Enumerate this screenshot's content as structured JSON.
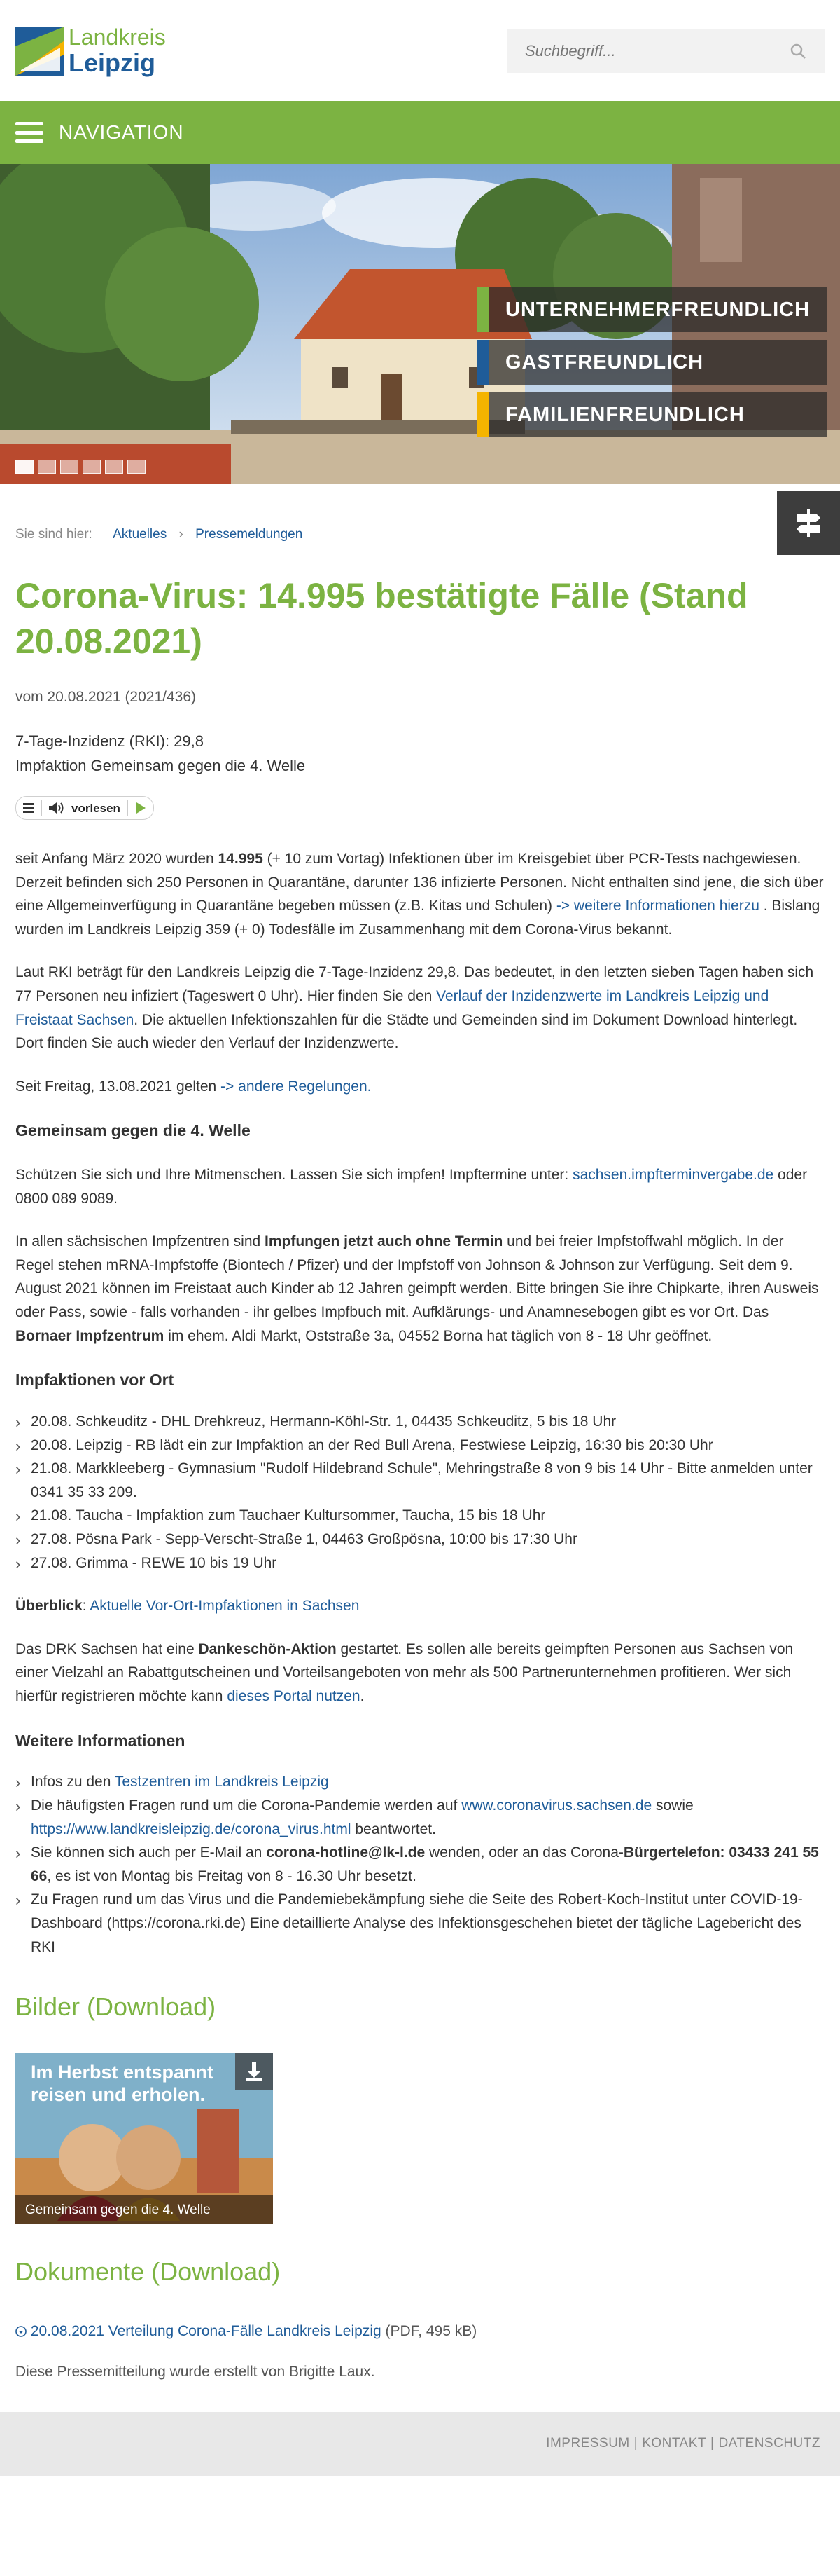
{
  "header": {
    "logo_line1": "Landkreis",
    "logo_line2": "Leipzig",
    "search_placeholder": "Suchbegriff..."
  },
  "nav": {
    "label": "NAVIGATION"
  },
  "hero": {
    "slogans": [
      {
        "text": "UNTERNEHMERFREUNDLICH",
        "color": "#7cb342"
      },
      {
        "text": "GASTFREUNDLICH",
        "color": "#1f5c99"
      },
      {
        "text": "FAMILIENFREUNDLICH",
        "color": "#f4b400"
      }
    ],
    "active_slide": 1,
    "slide_count": 6
  },
  "breadcrumb": {
    "prefix": "Sie sind hier:",
    "items": [
      "Aktuelles",
      "Pressemeldungen"
    ]
  },
  "article": {
    "title": "Corona-Virus: 14.995 bestätigte Fälle (Stand 20.08.2021)",
    "date": "vom 20.08.2021 (2021/436)",
    "lead_1": "7-Tage-Inzidenz (RKI): 29,8",
    "lead_2": "Impfaktion Gemeinsam gegen die 4. Welle",
    "reader_label": "vorlesen",
    "p1_a": "seit Anfang März 2020 wurden ",
    "p1_b": "14.995",
    "p1_c": " (+ 10 zum Vortag) Infektionen über im Kreisgebiet über PCR-Tests nachgewiesen. Derzeit befinden sich 250 Personen in Quarantäne, darunter 136 infizierte Personen. Nicht enthalten sind jene, die sich über eine Allgemeinverfügung in Quarantäne begeben müssen (z.B. Kitas und Schulen) ",
    "p1_link": "-> weitere Informationen hierzu",
    "p1_d": " . Bislang wurden im Landkreis Leipzig 359 (+ 0) Todesfälle im Zusammenhang mit dem Corona-Virus bekannt.",
    "p2_a": "Laut RKI beträgt für den Landkreis Leipzig die 7-Tage-Inzidenz 29,8. Das bedeutet, in den letzten sieben Tagen haben sich 77 Personen neu infiziert (Tageswert 0 Uhr). Hier finden Sie den ",
    "p2_link": "Verlauf der Inzidenzwerte im Landkreis Leipzig und Freistaat Sachsen",
    "p2_b": ". Die aktuellen Infektionszahlen für die Städte und Gemeinden sind im Dokument Download hinterlegt. Dort finden Sie auch wieder den Verlauf der Inzidenzwerte.",
    "p3_a": "Seit Freitag, 13.08.2021 gelten  ",
    "p3_link": "-> andere Regelungen.",
    "h_welle": "Gemeinsam gegen die 4. Welle",
    "p4_a": "Schützen Sie sich und Ihre Mitmenschen. Lassen Sie sich impfen! Impftermine unter: ",
    "p4_link": "sachsen.impfterminvergabe.de",
    "p4_b": " oder 0800 089 9089.",
    "p5_a": "In allen sächsischen Impfzentren sind ",
    "p5_b": "Impfungen jetzt auch ohne Termin",
    "p5_c": " und bei freier Impfstoffwahl möglich. In der Regel stehen mRNA-Impfstoffe (Biontech / Pfizer) und der Impfstoff von Johnson & Johnson zur Verfügung. Seit dem 9. August 2021 können im Freistaat auch Kinder ab 12 Jahren geimpft werden. Bitte bringen Sie ihre Chipkarte, ihren Ausweis oder Pass, sowie - falls vorhanden - ihr gelbes Impfbuch mit. Aufklärungs- und Anamnesebogen gibt es vor Ort. Das ",
    "p5_d": "Bornaer Impfzentrum",
    "p5_e": " im ehem. Aldi Markt, Oststraße 3a, 04552 Borna hat täglich von 8 - 18 Uhr geöffnet.",
    "h_vorort": "Impfaktionen vor Ort",
    "vorort": [
      "20.08. Schkeuditz - DHL Drehkreuz, Hermann-Köhl-Str. 1, 04435 Schkeuditz, 5 bis 18 Uhr",
      "20.08. Leipzig - RB lädt ein zur Impfaktion an der Red Bull Arena, Festwiese Leipzig, 16:30 bis 20:30 Uhr",
      "21.08. Markkleeberg -  Gymnasium \"Rudolf Hildebrand Schule\", Mehringstraße 8 von 9 bis 14 Uhr - Bitte anmelden unter 0341 35 33 209.",
      "21.08. Taucha - Impfaktion zum Tauchaer Kultursommer, Taucha, 15 bis 18 Uhr",
      "27.08. Pösna Park - Sepp-Verscht-Straße 1, 04463 Großpösna, 10:00 bis 17:30 Uhr",
      "27.08. Grimma - REWE 10 bis 19 Uhr"
    ],
    "ueberblick_label": "Überblick",
    "ueberblick_colon": ":  ",
    "ueberblick_link": "Aktuelle Vor-Ort-Impfaktionen in Sachsen",
    "p6_a": "Das DRK Sachsen hat eine ",
    "p6_b": "Dankeschön-Aktion",
    "p6_c": " gestartet. Es sollen alle bereits geimpften Personen aus Sachsen von einer Vielzahl an Rabattgutscheinen und Vorteilsangeboten von mehr als 500 Partnerunternehmen profitieren. Wer sich hierfür registrieren möchte kann ",
    "p6_link": "dieses Portal nutzen",
    "p6_d": ".",
    "h_weitere": "Weitere Informationen",
    "w1_a": "Infos zu den ",
    "w1_link": "Testzentren im Landkreis Leipzig",
    "w2_a": "Die häufigsten Fragen rund um die Corona-Pandemie werden auf ",
    "w2_link1": "www.coronavirus.sachsen.de",
    "w2_b": "  sowie ",
    "w2_link2": "https://www.landkreisleipzig.de/corona_virus.html",
    "w2_c": " beantwortet.",
    "w3_a": "Sie können sich auch per E-Mail an ",
    "w3_b": "corona-hotline@lk-l.de",
    "w3_c": " wenden, oder an das Corona-",
    "w3_d": "Bürgertelefon: 03433 241 55 66",
    "w3_e": ", es ist von Montag bis Freitag von 8 - 16.30 Uhr besetzt.",
    "w4": "Zu Fragen rund um das Virus und die Pandemiebekämpfung siehe die Seite des Robert-Koch-Institut unter COVID-19-Dashboard (https://corona.rki.de)  Eine detaillierte Analyse des Infektionsgeschehen bietet der tägliche Lagebericht des RKI"
  },
  "bilder": {
    "heading": "Bilder (Download)",
    "image_headline_1": "Im Herbst entspannt",
    "image_headline_2": "reisen und erholen.",
    "caption": "Gemeinsam gegen die 4. Welle"
  },
  "dokumente": {
    "heading": "Dokumente (Download)",
    "link": "20.08.2021 Verteilung Corona-Fälle Landkreis Leipzig",
    "size": " (PDF, 495 kB)"
  },
  "author": "Diese Pressemitteilung wurde erstellt von Brigitte Laux.",
  "footer": {
    "links": [
      "IMPRESSUM",
      "KONTAKT",
      "DATENSCHUTZ"
    ],
    "separator": "|"
  }
}
